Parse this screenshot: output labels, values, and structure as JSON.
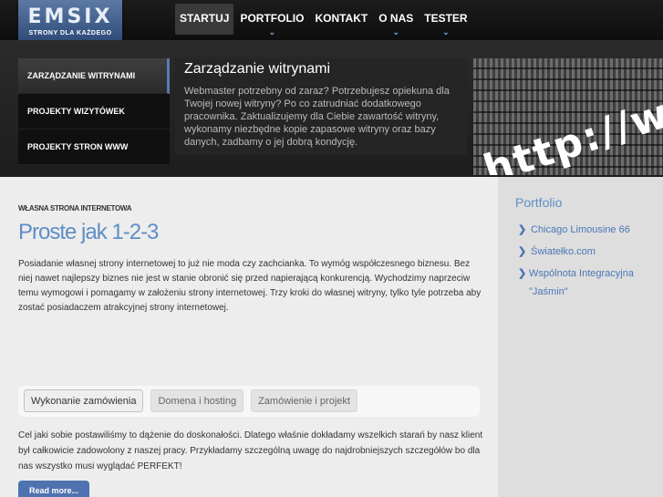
{
  "logo": {
    "word": "EMSIX",
    "tagline": "STRONY DLA KAŻDEGO"
  },
  "nav": [
    {
      "label": "STARTUJ",
      "has_submenu": false
    },
    {
      "label": "PORTFOLIO",
      "has_submenu": true
    },
    {
      "label": "KONTAKT",
      "has_submenu": false
    },
    {
      "label": "O NAS",
      "has_submenu": true
    },
    {
      "label": "TESTER",
      "has_submenu": true
    }
  ],
  "submenu": [
    {
      "label": "ZARZĄDZANIE WITRYNAMI"
    },
    {
      "label": "PROJEKTY WIZYTÓWEK"
    },
    {
      "label": "PROJEKTY STRON WWW"
    }
  ],
  "hero": {
    "title": "Zarządzanie witrynami",
    "description": "Webmaster potrzebny od zaraz? Potrzebujesz opiekuna dla Twojej nowej witryny? Po co zatrudniać dodatkowego pracownika. Zaktualizujemy dla Ciebie zawartość witryny, wykonamy niezbędne kopie zapasowe witryny oraz bazy danych, zadbamy o jej dobrą kondycję.",
    "image_text": "http://w"
  },
  "main": {
    "kicker": "WŁASNA STRONA INTERNETOWA",
    "headline": "Proste jak 1-2-3",
    "paragraph": "Posiadanie własnej strony internetowej to już nie moda czy zachcianka. To wymóg współczesnego biznesu. Bez niej nawet najlepszy biznes nie jest w stanie obronić się przed napierającą konkurencją. Wychodzimy naprzeciw temu wymogowi i pomagamy w założeniu strony internetowej. Trzy kroki do własnej witryny, tylko tyle potrzeba aby zostać posiadaczem atrakcyjnej strony internetowej.",
    "tabs": [
      {
        "label": "Wykonanie zamówienia"
      },
      {
        "label": "Domena i hosting"
      },
      {
        "label": "Zamówienie i projekt"
      }
    ],
    "tab_content": "Cel jaki sobie postawiliśmy to dążenie do doskonałości. Dlatego właśnie dokładamy wszelkich starań by nasz klient był całkowicie zadowolony z naszej pracy. Przykładamy szczególną uwagę do najdrobniejszych szczegółów bo dla nas wszystko musi wyglądać PERFEKT!",
    "read_more": "Read more..."
  },
  "sidebar": {
    "title": "Portfolio",
    "items": [
      {
        "label": "Chicago Limousine 66"
      },
      {
        "label": "Światełko.com"
      },
      {
        "label": "Wspólnota Integracyjna \"Jaśmin\""
      }
    ]
  },
  "colors": {
    "accent": "#5f8ec6",
    "link": "#4a77b6",
    "button": "#4e73b0",
    "topbar": "#141414"
  },
  "icons": {
    "nav_chevron": "chevron-down-icon",
    "list_arrow": "chevron-right-icon"
  }
}
